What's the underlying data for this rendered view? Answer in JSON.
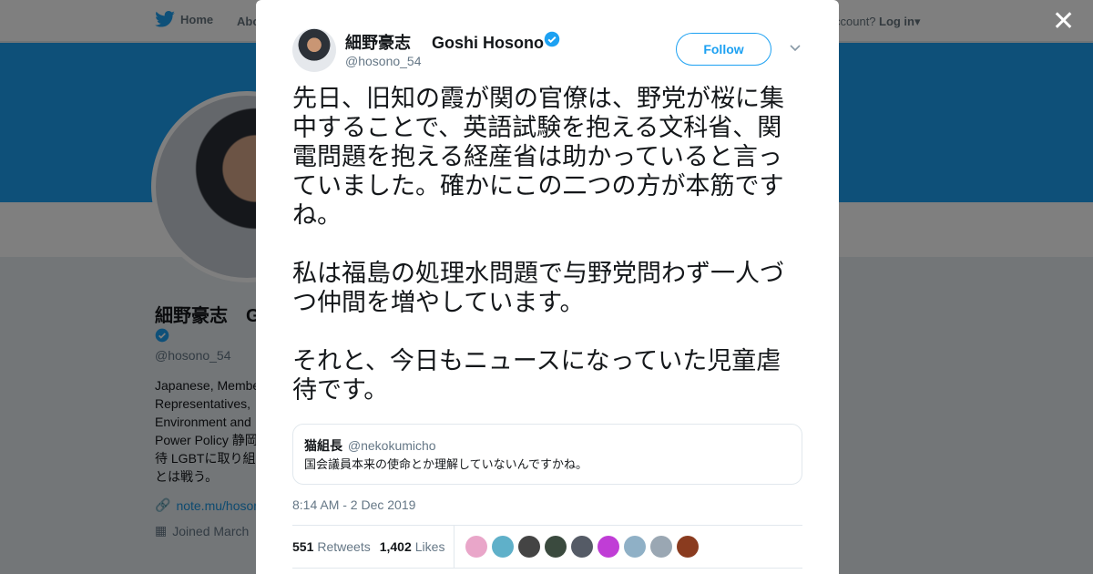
{
  "background": {
    "nav": {
      "home_label": "Home",
      "about_label": "Abo",
      "account_question": "ccount?",
      "login_label": "Log in"
    },
    "profile": {
      "name": "細野豪志　G",
      "handle": "@hosono_54",
      "bio": "Japanese, Member\nRepresentatives,\nEnvironment and\nPower Policy 静岡\n待 LGBTに取り組\nとは戦う。",
      "link": "note.mu/hoson",
      "joined": "Joined March"
    }
  },
  "tweet": {
    "author_name": "細野豪志　 Goshi Hosono",
    "author_handle": "@hosono_54",
    "follow_label": "Follow",
    "paragraphs": [
      "先日、旧知の霞が関の官僚は、野党が桜に集中することで、英語試験を抱える文科省、関電問題を抱える経産省は助かっていると言っていました。確かにこの二つの方が本筋ですね。",
      "私は福島の処理水問題で与野党問わず一人づつ仲間を増やしています。",
      "それと、今日もニュースになっていた児童虐待です。"
    ],
    "quote": {
      "name": "猫組長",
      "handle": "@nekokumicho",
      "text": "国会議員本来の使命とか理解していないんですかね。"
    },
    "timestamp": "8:14 AM - 2 Dec 2019",
    "retweets": {
      "count": "551",
      "label": "Retweets"
    },
    "likes": {
      "count": "1,402",
      "label": "Likes"
    },
    "liker_colors": [
      "#e9a6c9",
      "#5fb0c9",
      "#444444",
      "#3a4a3e",
      "#555b66",
      "#c03dd6",
      "#8fb0c6",
      "#9aa7b3",
      "#8a3b1f"
    ]
  },
  "colors": {
    "brand": "#1da1f2",
    "verified": "#1da1f2"
  }
}
